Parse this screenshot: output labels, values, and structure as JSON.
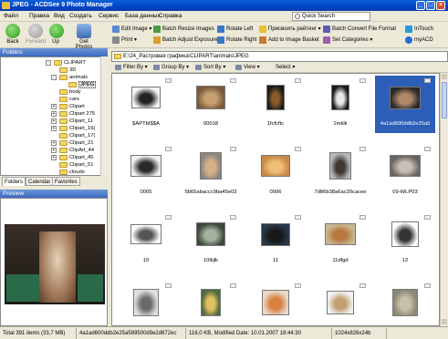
{
  "window": {
    "title": "JPEG - ACDSee 9 Photo Manager",
    "controls": [
      "_",
      "□",
      "×"
    ]
  },
  "menu": {
    "items": [
      "Файл",
      "Правка",
      "Вид",
      "Создать",
      "Сервис",
      "База данных",
      "Справка"
    ],
    "quick_search_placeholder": "Quick Search"
  },
  "toolbar": {
    "back_label": "Back",
    "forward_label": "Forward",
    "up_label": "Up",
    "get_photos_label": "Get Photos",
    "edit_image_label": "Edit Image",
    "print_label": "Print",
    "batch_resize_label": "Batch Resize Images",
    "batch_adjust_label": "Batch Adjust Exposure",
    "rotate_left_label": "Rotate Left",
    "rotate_right_label": "Rotate Right",
    "assign_rating_label": "Присвоить рейтинг",
    "add_to_basket_label": "Add to Image Basket",
    "batch_convert_label": "Batch Convert File Format",
    "set_categories_label": "Set Categories",
    "intouch_label": "InTouch",
    "myacd_label": "myACD"
  },
  "folders_panel": {
    "title": "Folders",
    "tree": [
      {
        "label": "CLIPART",
        "expanded": true
      },
      {
        "label": "3D"
      },
      {
        "label": "animals",
        "expanded": true
      },
      {
        "label": "JPEG",
        "selected": true
      },
      {
        "label": "body"
      },
      {
        "label": "cars"
      },
      {
        "label": "Clipart"
      },
      {
        "label": "Clipart 275"
      },
      {
        "label": "Clipart_11"
      },
      {
        "label": "Clipart_16("
      },
      {
        "label": "Clipart_17("
      },
      {
        "label": "Clipart_21"
      },
      {
        "label": "ClipArt_44"
      },
      {
        "label": "Clipart_45"
      },
      {
        "label": "Clipart_51"
      },
      {
        "label": "clouds"
      }
    ],
    "tabs": [
      "Folders",
      "Calendar",
      "Favorites"
    ]
  },
  "preview_panel": {
    "title": "Preview"
  },
  "address": {
    "path": "E:\\24_Растровая графика\\CLIPART\\animals\\JPEG"
  },
  "filterbar": {
    "filter_label": "Filter By",
    "group_label": "Group By",
    "sort_label": "Sort By",
    "view_label": "View",
    "select_label": "Select"
  },
  "thumbnails": [
    {
      "caption": "$APTbI$$A"
    },
    {
      "caption": "00018"
    },
    {
      "caption": "1fcfcftc"
    },
    {
      "caption": "1mklk"
    },
    {
      "caption": "4a1ad600ddb2e25a5",
      "selected": true
    },
    {
      "caption": "0005"
    },
    {
      "caption": "5b65abaccc9ba45e03"
    },
    {
      "caption": "0006"
    },
    {
      "caption": "7d86b38a6ac20cacee"
    },
    {
      "caption": "09-WLP03"
    },
    {
      "caption": "10"
    },
    {
      "caption": "10lkjlk"
    },
    {
      "caption": "11"
    },
    {
      "caption": "11dfgd"
    },
    {
      "caption": "12"
    },
    {
      "caption": ""
    },
    {
      "caption": ""
    },
    {
      "caption": ""
    },
    {
      "caption": ""
    },
    {
      "caption": ""
    }
  ],
  "status": {
    "total": "Total 391 items (33,7 MB)",
    "filename": "4a1ad600ddb2e25a589500d9e2d672ec",
    "details": "116,0 KB, Modified Date: 10.01.2007 18:44:30",
    "dimensions": "1024x826x24b"
  },
  "colors": {
    "titlebar": "#0a5fd8",
    "selection": "#2d5fb8",
    "panel_header": "#4a78c8"
  }
}
